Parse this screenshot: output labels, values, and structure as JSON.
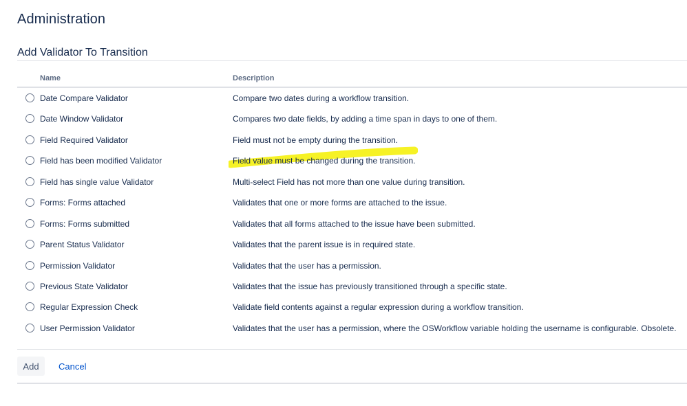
{
  "page": {
    "title": "Administration"
  },
  "section": {
    "title": "Add Validator To Transition"
  },
  "table": {
    "headers": {
      "name": "Name",
      "description": "Description"
    },
    "rows": [
      {
        "name": "Date Compare Validator",
        "description": "Compare two dates during a workflow transition."
      },
      {
        "name": "Date Window Validator",
        "description": "Compares two date fields, by adding a time span in days to one of them."
      },
      {
        "name": "Field Required Validator",
        "description": "Field must not be empty during the transition."
      },
      {
        "name": "Field has been modified Validator",
        "description": "Field value must be changed during the transition.",
        "highlighted": true
      },
      {
        "name": "Field has single value Validator",
        "description": "Multi-select Field has not more than one value during transition."
      },
      {
        "name": "Forms: Forms attached",
        "description": "Validates that one or more forms are attached to the issue."
      },
      {
        "name": "Forms: Forms submitted",
        "description": "Validates that all forms attached to the issue have been submitted."
      },
      {
        "name": "Parent Status Validator",
        "description": "Validates that the parent issue is in required state."
      },
      {
        "name": "Permission Validator",
        "description": "Validates that the user has a permission."
      },
      {
        "name": "Previous State Validator",
        "description": "Validates that the issue has previously transitioned through a specific state."
      },
      {
        "name": "Regular Expression Check",
        "description": "Validate field contents against a regular expression during a workflow transition."
      },
      {
        "name": "User Permission Validator",
        "description": "Validates that the user has a permission, where the OSWorkflow variable holding the username is configurable. Obsolete."
      }
    ]
  },
  "actions": {
    "add_label": "Add",
    "cancel_label": "Cancel"
  },
  "colors": {
    "highlight": "#f5f000",
    "link": "#0052cc",
    "heading": "#172b4d"
  }
}
